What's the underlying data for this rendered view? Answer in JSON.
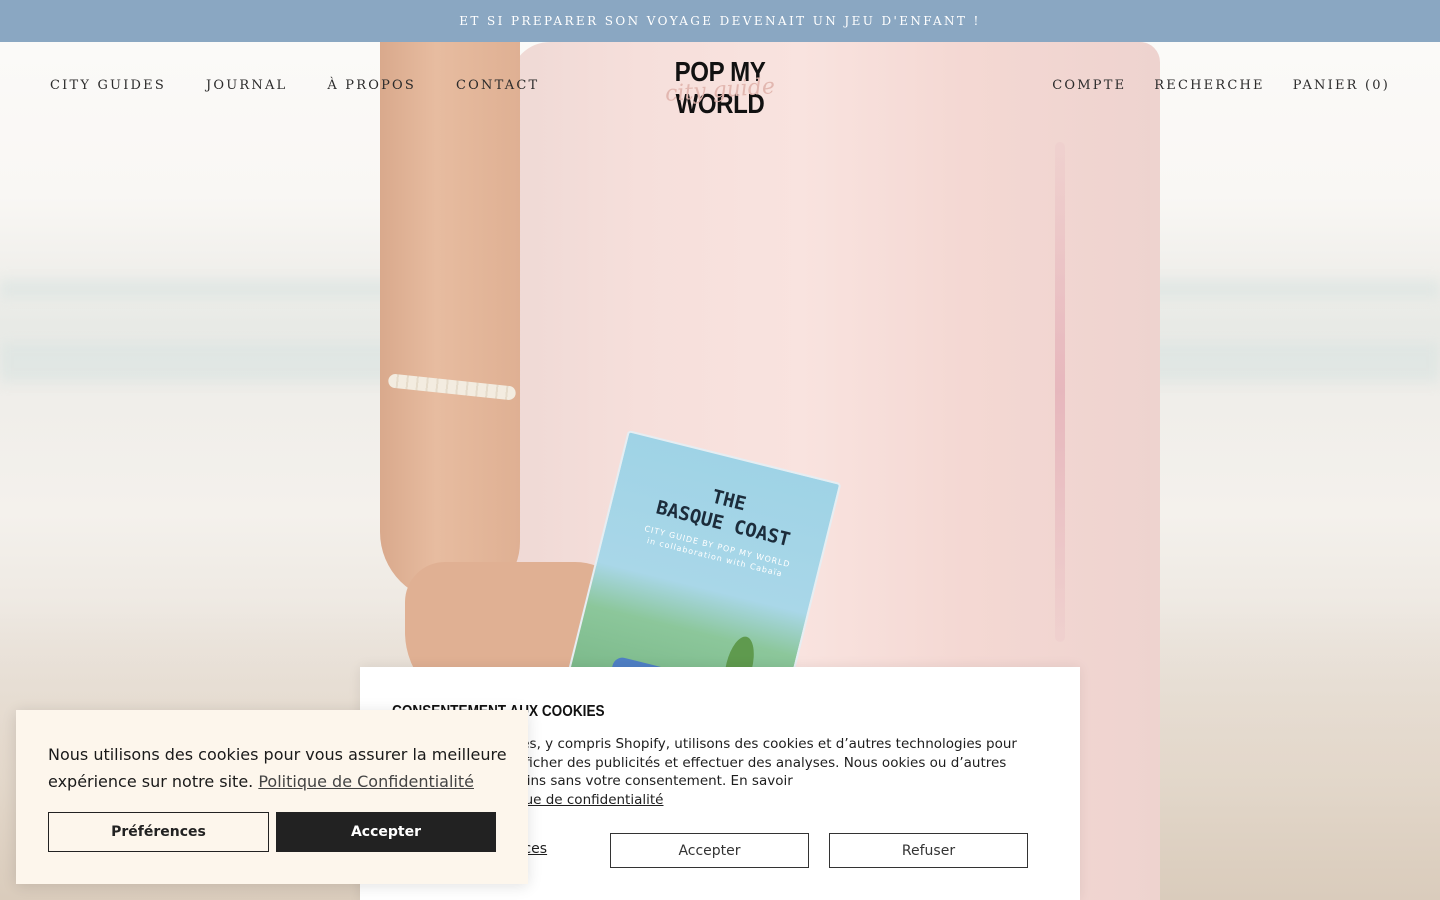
{
  "announcement": {
    "text": "ET SI PREPARER SON VOYAGE DEVENAIT UN JEU D'ENFANT !"
  },
  "header": {
    "nav_left": [
      "CITY GUIDES",
      "JOURNAL",
      "À PROPOS",
      "CONTACT"
    ],
    "logo": {
      "main": "POP MY WORLD",
      "script": "city guide"
    },
    "nav_right": [
      "COMPTE",
      "RECHERCHE",
      "PANIER (0)"
    ]
  },
  "hero": {
    "book": {
      "title_line1": "THE",
      "title_line2": "BASQUE COAST",
      "subtitle_line1": "CITY GUIDE BY POP MY WORLD",
      "subtitle_line2": "in collaboration with Cabaïa"
    }
  },
  "consent_panel": {
    "title": "CONSENTEMENT AUX COOKIES",
    "body_visible": "res, y compris Shopify, utilisons des cookies et d’autres technologies pour expérience, vous afficher des publicités et effectuer des analyses. Nous ookies ou d’autres technologies à ces fins sans votre consentement. En savoir",
    "body_link": "que de confidentialité",
    "preferences_link": "ences",
    "accept_label": "Accepter",
    "refuse_label": "Refuser"
  },
  "cookie_banner": {
    "text": "Nous utilisons des cookies pour vous assurer la meilleure expérience sur notre site.",
    "privacy_link": "Politique de Confidentialité",
    "preferences_label": "Préférences",
    "accept_label": "Accepter"
  }
}
